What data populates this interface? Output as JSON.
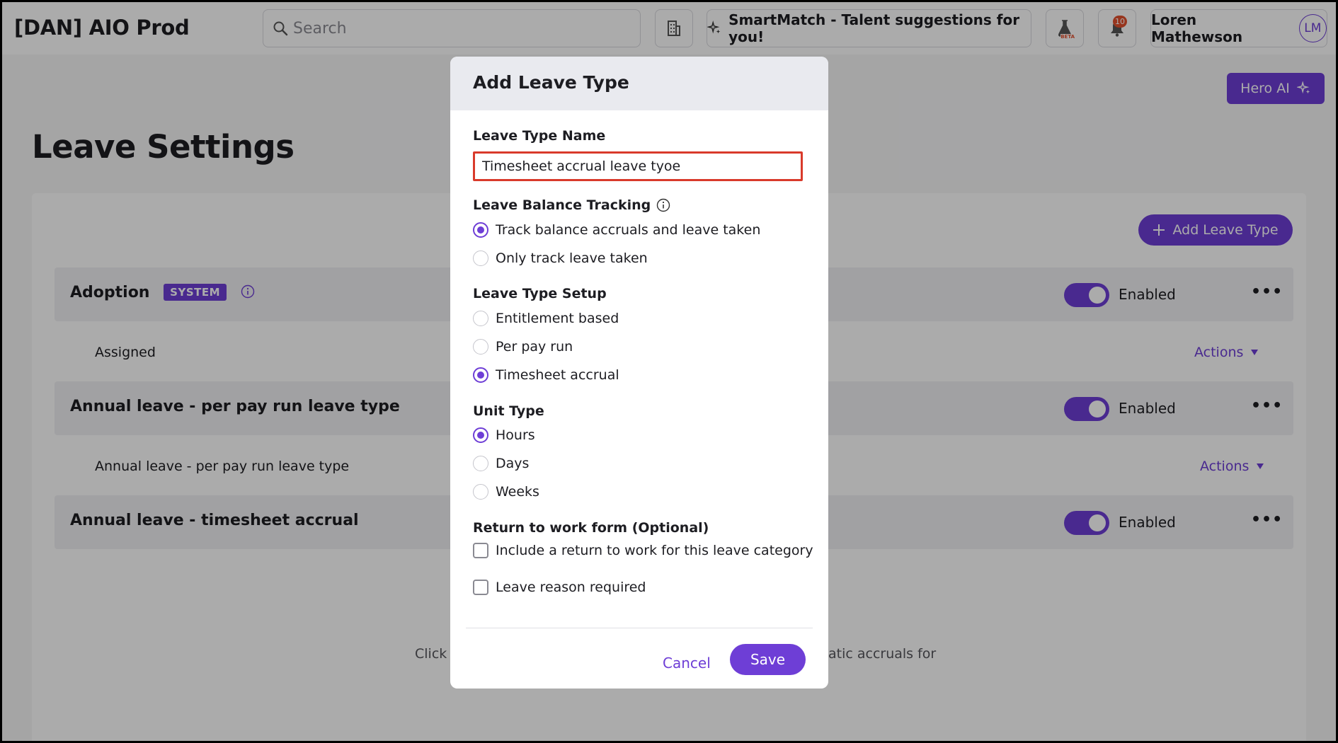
{
  "app": {
    "title": "[DAN] AIO Prod"
  },
  "search": {
    "placeholder": "Search"
  },
  "topbar": {
    "smartmatch_label": "SmartMatch - Talent suggestions for you!",
    "beta_label": "BETA",
    "notification_count": "10",
    "user_name": "Loren Mathewson",
    "user_initials": "LM"
  },
  "hero_ai": {
    "label": "Hero AI"
  },
  "page": {
    "title": "Leave Settings",
    "add_button_label": "Add Leave Type"
  },
  "leave_types": [
    {
      "name": "Adoption",
      "badge": "SYSTEM",
      "status": "Enabled",
      "sub_label": "Assigned",
      "actions_label": "Actions"
    },
    {
      "name": "Annual leave - per pay run leave type",
      "status": "Enabled",
      "sub_label": "Annual leave - per pay run leave type",
      "actions_label": "Actions"
    },
    {
      "name": "Annual leave - timesheet accrual",
      "status": "Enabled"
    }
  ],
  "footer_text": {
    "left": "Click",
    "right": "atic accruals for"
  },
  "modal": {
    "title": "Add Leave Type",
    "name_label": "Leave Type Name",
    "name_value": "Timesheet accrual leave tyoe",
    "balance_label": "Leave Balance Tracking",
    "balance_options": [
      "Track balance accruals and leave taken",
      "Only track leave taken"
    ],
    "balance_selected": 0,
    "setup_label": "Leave Type Setup",
    "setup_options": [
      "Entitlement based",
      "Per pay run",
      "Timesheet accrual"
    ],
    "setup_selected": 2,
    "unit_label": "Unit Type",
    "unit_options": [
      "Hours",
      "Days",
      "Weeks"
    ],
    "unit_selected": 0,
    "rtw_label": "Return to work form (Optional)",
    "rtw_checkbox_label": "Include a return to work for this leave category",
    "reason_checkbox_label": "Leave reason required",
    "cancel_label": "Cancel",
    "save_label": "Save"
  },
  "colors": {
    "accent": "#6e3ed6",
    "error_border": "#d93a2b",
    "notification": "#e24f2e"
  }
}
